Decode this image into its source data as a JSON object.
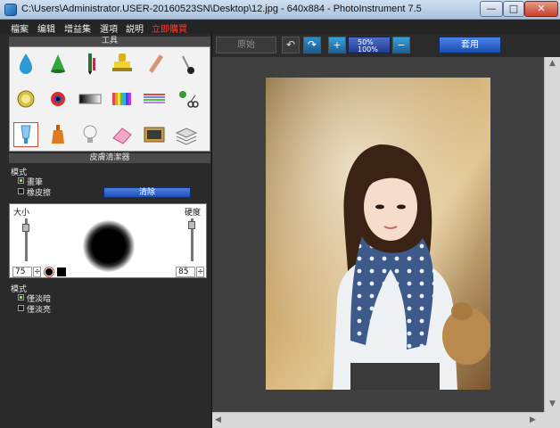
{
  "window": {
    "title": "C:\\Users\\Administrator.USER-20160523SN\\Desktop\\12.jpg - 640x884 - PhotoInstrument 7.5",
    "buttons": {
      "minimize": "—",
      "maximize": "□",
      "close": "✕"
    }
  },
  "menu": {
    "items": [
      "檔案",
      "编辑",
      "增益集",
      "選項",
      "説明"
    ],
    "register": "立即購買"
  },
  "tools": {
    "header": "工具",
    "items": [
      {
        "name": "water-drop-icon",
        "color": "#2c9ad6"
      },
      {
        "name": "cone-icon",
        "color": "#31a63a"
      },
      {
        "name": "pencil-brush-icon",
        "color": "#2d6b3a"
      },
      {
        "name": "stamp-icon",
        "color": "#e5c51e"
      },
      {
        "name": "nail-file-icon",
        "color": "#d79578"
      },
      {
        "name": "pin-icon",
        "color": "#222222"
      },
      {
        "name": "lemon-icon",
        "color": "#d8c140"
      },
      {
        "name": "eye-icon",
        "color": "#d92c2c"
      },
      {
        "name": "gradient-bar-icon",
        "color": "#777777"
      },
      {
        "name": "color-bars-icon",
        "color": "#e24848"
      },
      {
        "name": "palette-stripes-icon",
        "color": "#6e8fd5"
      },
      {
        "name": "clone-scissors-icon",
        "color": "#3a9a3a"
      },
      {
        "name": "paint-tube-icon",
        "color": "#2f8fd0"
      },
      {
        "name": "vase-icon",
        "color": "#e07a20"
      },
      {
        "name": "bulb-icon",
        "color": "#dadada"
      },
      {
        "name": "eraser-icon",
        "color": "#d04c86"
      },
      {
        "name": "photo-frame-icon",
        "color": "#c79a4a"
      },
      {
        "name": "layers-icon",
        "color": "#8c8c8c"
      }
    ]
  },
  "panel": {
    "header": "皮膚清潔器",
    "mode_label": "模式",
    "mode_option1": "畫筆",
    "mode_option2": "橡皮擦",
    "clear_button": "清除",
    "size_label": "大小",
    "hardness_label": "硬度",
    "size_value": "75",
    "hardness_value": "85",
    "mode2_label": "模式",
    "mode2_option1": "僅淡暗",
    "mode2_option2": "僅淡亮"
  },
  "toolbar": {
    "original": "原始",
    "undo": "↶",
    "redo": "↷",
    "zoom_in": "+",
    "zoom_50": "50%",
    "zoom_100": "100%",
    "zoom_out": "−",
    "apply": "套用"
  },
  "colors": {
    "accent_blue": "#1e4fb4",
    "menu_highlight": "#ff3a2a"
  }
}
